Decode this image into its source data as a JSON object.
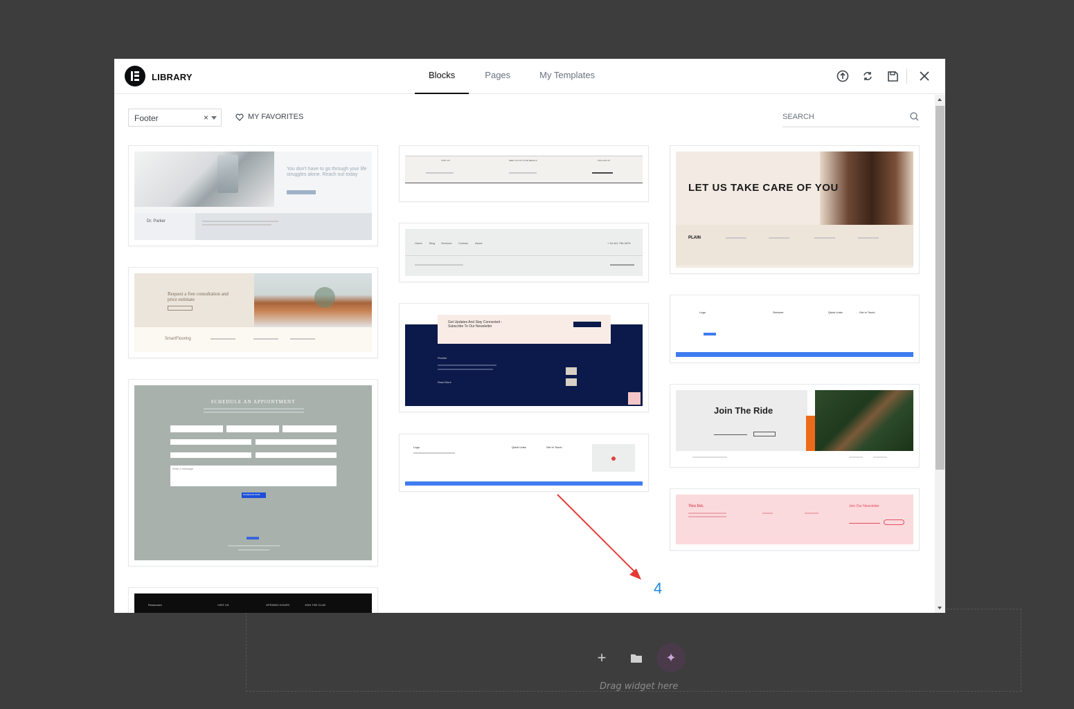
{
  "modal": {
    "title": "LIBRARY",
    "tabs": [
      {
        "label": "Blocks",
        "active": true
      },
      {
        "label": "Pages",
        "active": false
      },
      {
        "label": "My Templates",
        "active": false
      }
    ],
    "header_icons": [
      "upload-icon",
      "sync-icon",
      "save-icon",
      "close-icon"
    ]
  },
  "filter": {
    "category_value": "Footer",
    "clear_glyph": "×",
    "my_favorites_label": "MY FAVORITES",
    "search_placeholder": "SEARCH"
  },
  "templates": {
    "doctor": {
      "heading": "You don't have to go through your life struggles alone. Reach out today",
      "name": "Dr. Parker"
    },
    "flooring": {
      "heading": "Request a free consultation and price estimate",
      "brand": "SmartFlooring"
    },
    "appointment": {
      "heading": "SCHEDULE AN APPOINTMENT",
      "message_placeholder": "Write a message",
      "button": "SCHEDULE NOW"
    },
    "contact_row": {
      "cols": [
        "VISIT US",
        "MEET US ON YOUR BEHALF",
        "FOLLOW US"
      ]
    },
    "nav_footer": {
      "links": [
        "Home",
        "Blog",
        "Services",
        "Contact",
        "About"
      ],
      "phone": "+ 44 441 756 0675"
    },
    "newsletter_navy": {
      "heading": "Get Updates And Stay Connected - Subscribe To Our Newsletter",
      "brand": "Pinelist",
      "more": "Read More"
    },
    "logo_footer": {
      "logo": "Logo",
      "quick_links": "Quick Links",
      "get_in_touch": "Get In Touch"
    },
    "beauty": {
      "heading": "LET US TAKE CARE OF YOU",
      "brand": "PLAIN"
    },
    "blue_footer": {
      "logo": "Logo",
      "services": "Services",
      "quick_links": "Quick Links",
      "get_in_touch": "Get In Touch"
    },
    "ride": {
      "heading": "Join The Ride"
    },
    "pink": {
      "brand": "You Inc.",
      "newsletter": "Join Our Newsletter"
    },
    "dark_footer": {
      "cols": [
        "Restaurant",
        "VISIT US",
        "OPENING HOURS",
        "JOIN THE CLUB"
      ]
    }
  },
  "annotation": {
    "number": "4"
  },
  "background": {
    "hint": "Drag widget here"
  }
}
